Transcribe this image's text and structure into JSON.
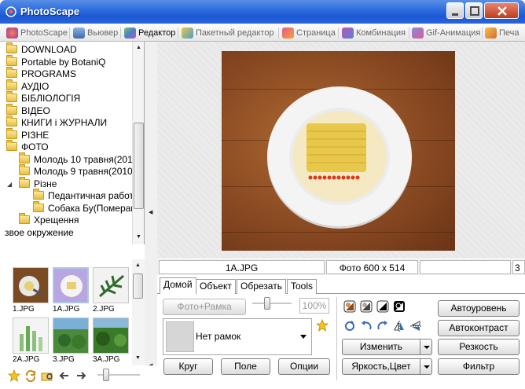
{
  "window": {
    "title": "PhotoScape"
  },
  "tabs": [
    {
      "label": "PhotoScape",
      "icon": "photoscape-icon",
      "active": false
    },
    {
      "label": "Вьювер",
      "icon": "viewer-icon",
      "active": false
    },
    {
      "label": "Редактор",
      "icon": "editor-icon",
      "active": true
    },
    {
      "label": "Пакетный редактор",
      "icon": "batch-editor-icon",
      "active": false
    },
    {
      "label": "Страница",
      "icon": "page-icon",
      "active": false
    },
    {
      "label": "Комбинация",
      "icon": "combine-icon",
      "active": false
    },
    {
      "label": "Gif-Анимация",
      "icon": "gif-icon",
      "active": false
    },
    {
      "label": "Печа",
      "icon": "print-icon",
      "active": false
    }
  ],
  "tree": {
    "items": [
      {
        "label": "DOWNLOAD",
        "indent": 0
      },
      {
        "label": "Portable by BotaniQ",
        "indent": 0
      },
      {
        "label": "PROGRAMS",
        "indent": 0
      },
      {
        "label": "АУДІО",
        "indent": 0
      },
      {
        "label": "БІБЛІОЛОГІЯ",
        "indent": 0
      },
      {
        "label": "ВІДЕО",
        "indent": 0
      },
      {
        "label": "КНИГИ і ЖУРНАЛИ",
        "indent": 0
      },
      {
        "label": "РІЗНЕ",
        "indent": 0
      },
      {
        "label": "ФОТО",
        "indent": 0
      },
      {
        "label": "Молодь 10 травня(201",
        "indent": 1
      },
      {
        "label": "Молодь 9 травня(2010",
        "indent": 1
      },
      {
        "label": "Різне",
        "indent": 1
      },
      {
        "label": "Педантичная работ",
        "indent": 2
      },
      {
        "label": "Собака Бу(Померан",
        "indent": 2
      },
      {
        "label": "Хрещення",
        "indent": 1
      },
      {
        "label": "звое окружение",
        "indent": -1
      }
    ]
  },
  "thumbnails": [
    {
      "label": "1.JPG",
      "selected": false
    },
    {
      "label": "1A.JPG",
      "selected": true
    },
    {
      "label": "2.JPG",
      "selected": false
    },
    {
      "label": "2A.JPG",
      "selected": false
    },
    {
      "label": "3.JPG",
      "selected": false
    },
    {
      "label": "3A.JPG",
      "selected": false
    }
  ],
  "status": {
    "filename": "1A.JPG",
    "photo_info": "Фото 600 x 514",
    "extra": "",
    "right_edge": "3"
  },
  "editor": {
    "tabs": [
      "Домой",
      "Объект",
      "Обрезать",
      "Tools"
    ],
    "active_tab": "Домой",
    "photo_frame_button": "Фото+Рамка",
    "percent_value": "100%",
    "frame_value": "Нет рамок",
    "circle_button": "Круг",
    "margin_button": "Поле",
    "options_button": "Опции",
    "change_button": "Изменить",
    "brightness_button": "Яркость,Цвет",
    "auto_level_button": "Автоуровень",
    "auto_contrast_button": "Автоконтраст",
    "sharpness_button": "Резкость",
    "filter_button": "Фильтр"
  }
}
